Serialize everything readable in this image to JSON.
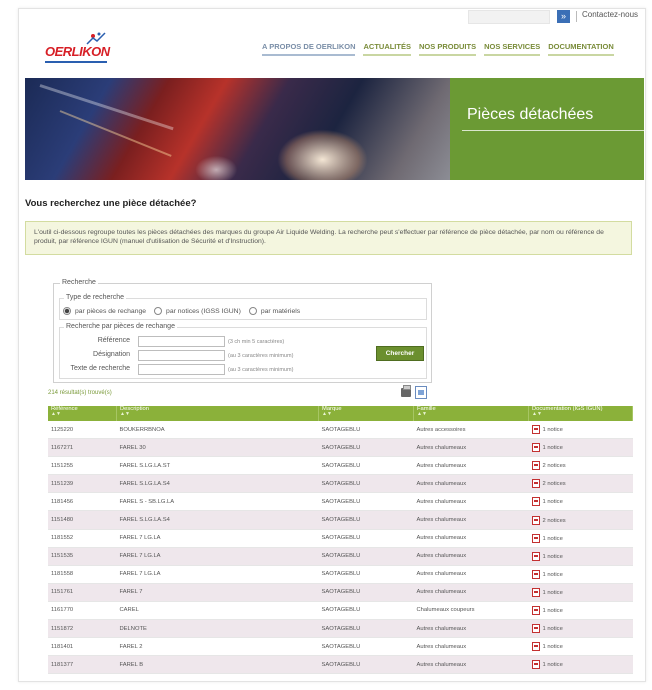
{
  "header": {
    "search_placeholder": "",
    "search_button": "»",
    "contact_label": "Contactez-nous",
    "logo_text": "OERLIKON",
    "nav": [
      "A PROPOS DE OERLIKON",
      "ACTUALITÉS",
      "NOS PRODUITS",
      "NOS SERVICES",
      "DOCUMENTATION"
    ]
  },
  "banner": {
    "title": "Pièces détachées"
  },
  "page": {
    "heading": "Vous recherchez une pièce détachée?",
    "intro": "L'outil ci-dessous regroupe toutes les pièces détachées des marques du groupe Air Liquide Welding. La recherche peut s'effectuer par référence de pièce détachée, par nom ou référence de produit, par référence IGUN (manuel d'utilisation de Sécurité et d'Instruction)."
  },
  "search": {
    "legend": "Recherche",
    "type_legend": "Type de recherche",
    "radio_options": [
      {
        "label": "par pièces de rechange",
        "selected": true
      },
      {
        "label": "par notices (IGSS IGUN)",
        "selected": false
      },
      {
        "label": "par matériels",
        "selected": false
      }
    ],
    "spare_legend": "Recherche par pièces de rechange",
    "fields": [
      {
        "label": "Référence",
        "hint": "(3 ch min 5 caractères)"
      },
      {
        "label": "Désignation",
        "hint": "(au 3 caractères minimum)"
      },
      {
        "label": "Texte de recherche",
        "hint": "(au 3 caractères minimum)"
      }
    ],
    "submit_label": "Chercher"
  },
  "results": {
    "count_text": "214 résultat(s) trouvé(s)",
    "columns": [
      "Référence",
      "Description",
      "Marque",
      "Famille",
      "Documentation (IGS IGUN)"
    ],
    "sort_hint": "▲▼",
    "rows": [
      [
        "1125220",
        "BOUKERRBNOA",
        "SAOTAGEBLU",
        "Autres accessoires",
        "1 notice"
      ],
      [
        "1167271",
        "FAREL 30",
        "SAOTAGEBLU",
        "Autres chalumeaux",
        "1 notice"
      ],
      [
        "1151255",
        "FAREL S.LG.LA.ST",
        "SAOTAGEBLU",
        "Autres chalumeaux",
        "2 notices"
      ],
      [
        "1151239",
        "FAREL S.LG.LA.S4",
        "SAOTAGEBLU",
        "Autres chalumeaux",
        "2 notices"
      ],
      [
        "1181456",
        "FAREL S - SB.LG.LA",
        "SAOTAGEBLU",
        "Autres chalumeaux",
        "1 notice"
      ],
      [
        "1151480",
        "FAREL S.LG.LA.S4",
        "SAOTAGEBLU",
        "Autres chalumeaux",
        "2 notices"
      ],
      [
        "1181552",
        "FAREL 7 LG.LA",
        "SAOTAGEBLU",
        "Autres chalumeaux",
        "1 notice"
      ],
      [
        "1151535",
        "FAREL 7 LG.LA",
        "SAOTAGEBLU",
        "Autres chalumeaux",
        "1 notice"
      ],
      [
        "1181558",
        "FAREL 7 LG.LA",
        "SAOTAGEBLU",
        "Autres chalumeaux",
        "1 notice"
      ],
      [
        "1151761",
        "FAREL 7",
        "SAOTAGEBLU",
        "Autres chalumeaux",
        "1 notice"
      ],
      [
        "1161770",
        "CAREL",
        "SAOTAGEBLU",
        "Chalumeaux coupeurs",
        "1 notice"
      ],
      [
        "1151872",
        "DELNOTE",
        "SAOTAGEBLU",
        "Autres chalumeaux",
        "1 notice"
      ],
      [
        "1181401",
        "FAREL 2",
        "SAOTAGEBLU",
        "Autres chalumeaux",
        "1 notice"
      ],
      [
        "1181377",
        "FAREL B",
        "SAOTAGEBLU",
        "Autres chalumeaux",
        "1 notice"
      ]
    ]
  },
  "colors": {
    "brand_green": "#6b9a34",
    "table_header_green": "#8bb13a",
    "logo_red": "#d71f26",
    "logo_blue": "#2a5fb0"
  }
}
